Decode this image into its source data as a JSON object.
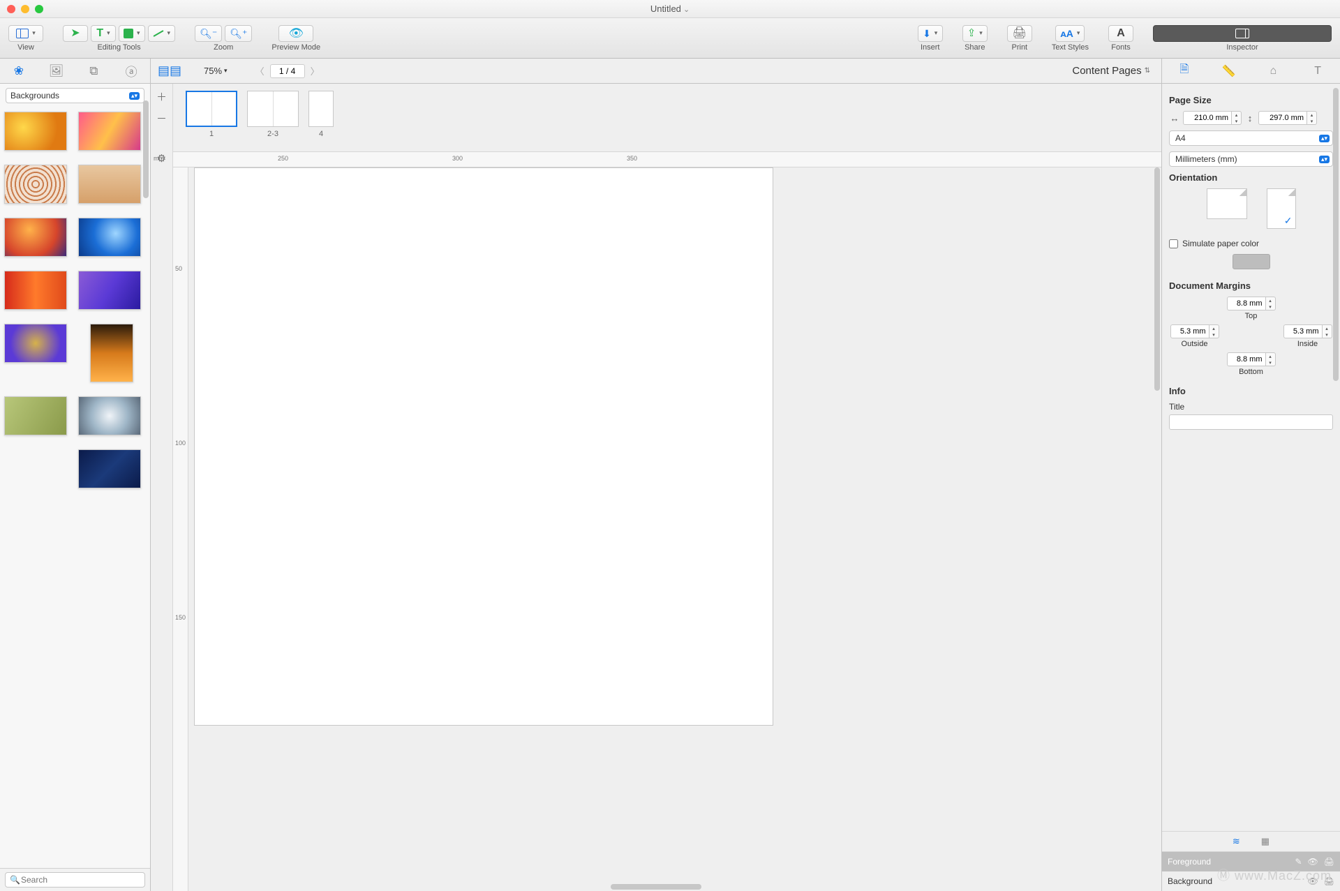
{
  "title": "Untitled",
  "toolbar": {
    "view": "View",
    "editing_tools": "Editing Tools",
    "zoom": "Zoom",
    "preview": "Preview Mode",
    "insert": "Insert",
    "share": "Share",
    "print": "Print",
    "text_styles": "Text Styles",
    "fonts": "Fonts",
    "inspector": "Inspector"
  },
  "secbar": {
    "zoom": "75%",
    "page_indicator": "1 / 4",
    "content_pages": "Content Pages"
  },
  "sidebar": {
    "category": "Backgrounds",
    "search_placeholder": "Search"
  },
  "thumbs": {
    "p1": "1",
    "p23": "2-3",
    "p4": "4"
  },
  "ruler": {
    "unit": "mm",
    "h": {
      "t250": "250",
      "t300": "300",
      "t350": "350"
    },
    "v": {
      "t50": "50",
      "t100": "100",
      "t150": "150"
    }
  },
  "inspector": {
    "page_size": "Page Size",
    "width": "210.0 mm",
    "height": "297.0 mm",
    "preset": "A4",
    "units": "Millimeters (mm)",
    "orientation": "Orientation",
    "simulate": "Simulate paper color",
    "doc_margins": "Document Margins",
    "top_v": "8.8 mm",
    "top_l": "Top",
    "outside_v": "5.3 mm",
    "outside_l": "Outside",
    "inside_v": "5.3 mm",
    "inside_l": "Inside",
    "bottom_v": "8.8 mm",
    "bottom_l": "Bottom",
    "info": "Info",
    "title_l": "Title",
    "layer_fg": "Foreground",
    "layer_bg": "Background"
  },
  "watermark": "Ⓜ www.MacZ.com"
}
